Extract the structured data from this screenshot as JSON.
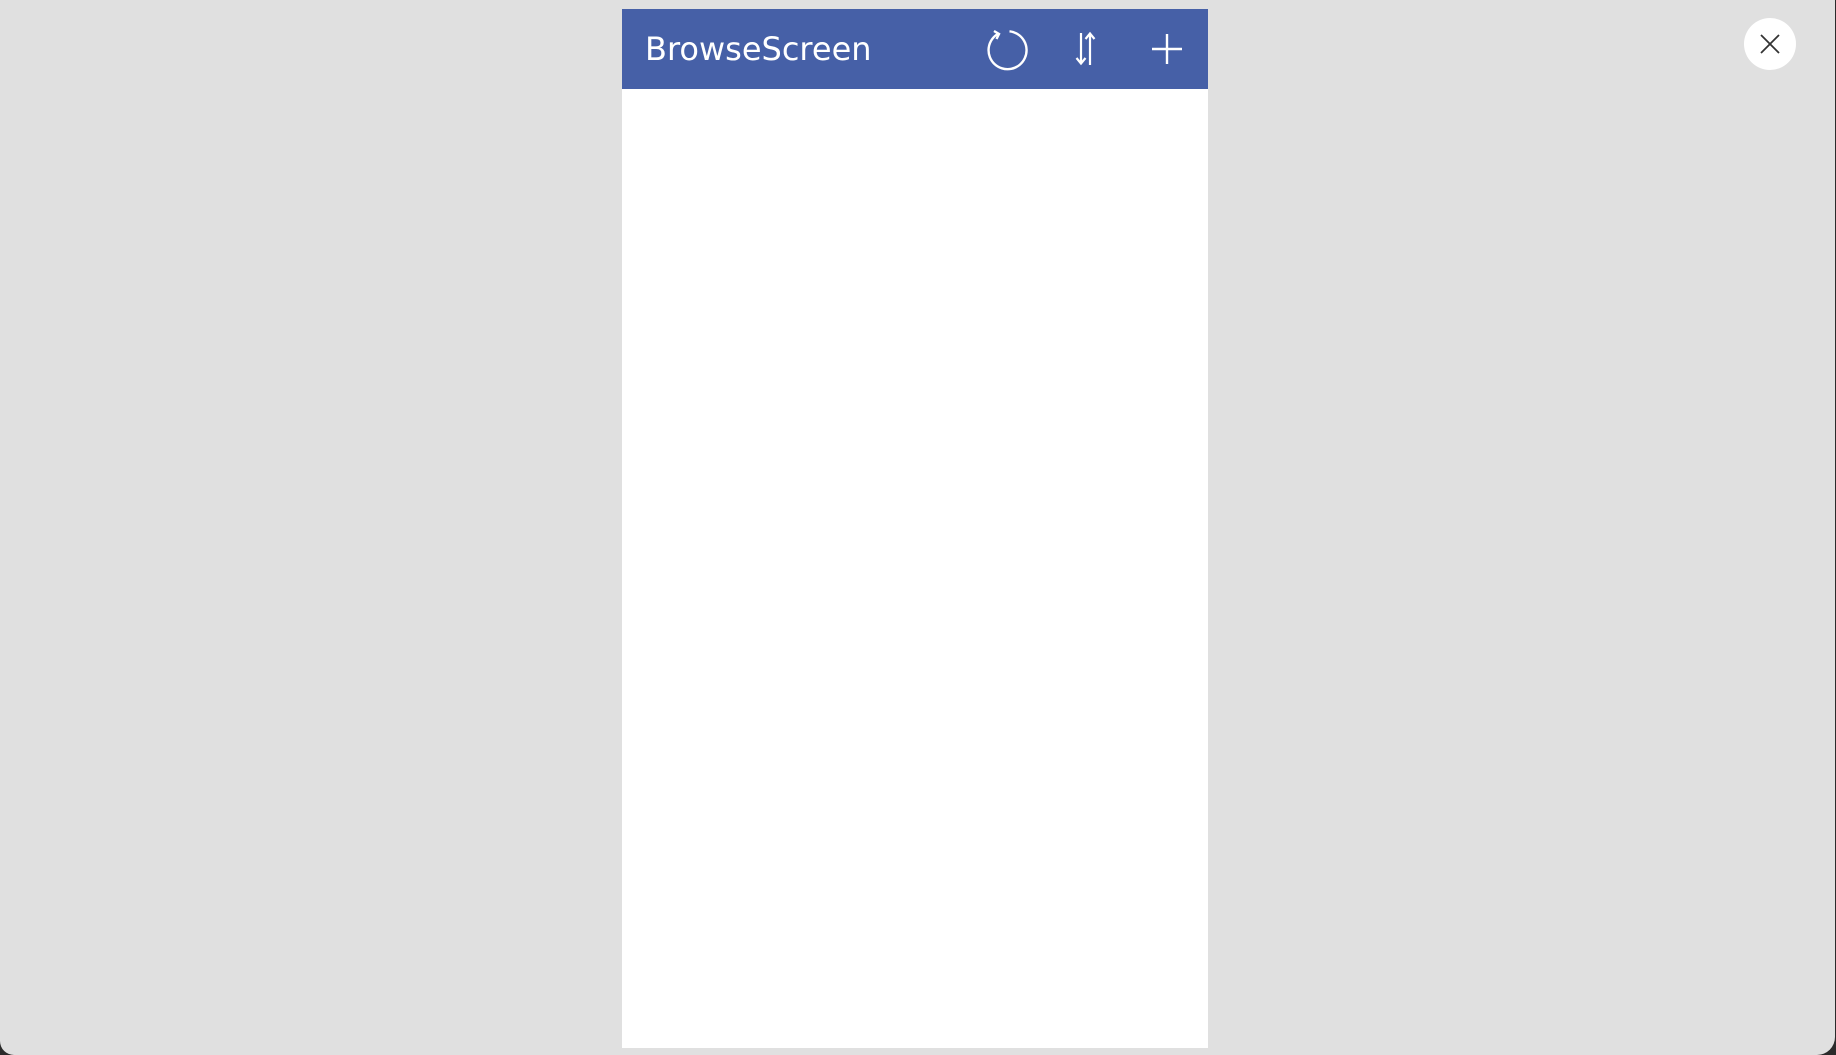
{
  "screen": {
    "title": "BrowseScreen"
  },
  "header": {
    "actions": [
      {
        "name": "refresh",
        "icon": "refresh-icon"
      },
      {
        "name": "sort",
        "icon": "sort-icon"
      },
      {
        "name": "add",
        "icon": "add-icon"
      }
    ]
  },
  "overlay": {
    "close_icon": "close-icon"
  },
  "colors": {
    "header_bg": "#4660a7",
    "header_fg": "#ffffff",
    "canvas_bg": "#e0e0e0",
    "screen_bg": "#ffffff"
  }
}
